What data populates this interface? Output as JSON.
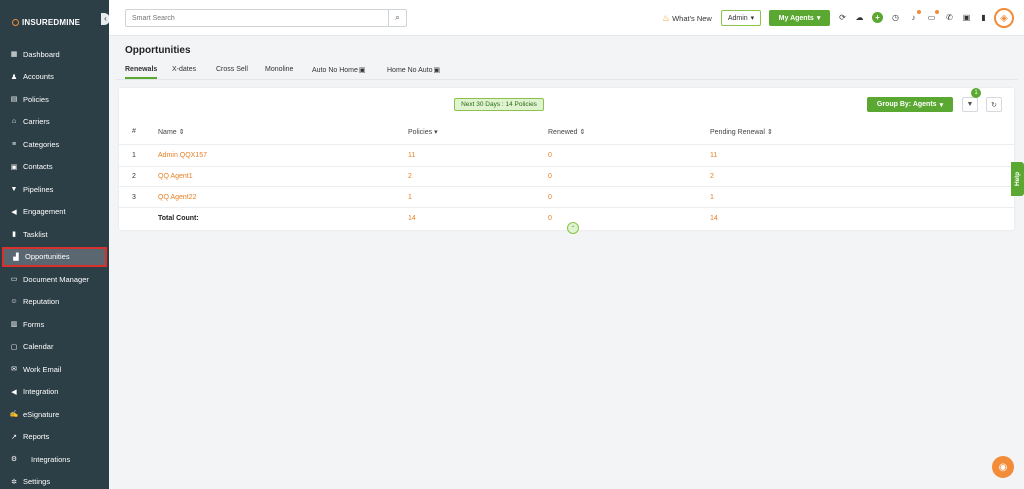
{
  "app": {
    "logo_prefix": "INSURED",
    "logo_suffix": "MINE",
    "collapse_icon": "‹"
  },
  "sidebar": {
    "items": [
      {
        "label": "Dashboard",
        "icon": "dashboard-icon",
        "glyph": "▦"
      },
      {
        "label": "Accounts",
        "icon": "accounts-icon",
        "glyph": "♟"
      },
      {
        "label": "Policies",
        "icon": "policies-icon",
        "glyph": "▤"
      },
      {
        "label": "Carriers",
        "icon": "carriers-icon",
        "glyph": "⌂"
      },
      {
        "label": "Categories",
        "icon": "categories-icon",
        "glyph": "≡"
      },
      {
        "label": "Contacts",
        "icon": "contacts-icon",
        "glyph": "▣"
      },
      {
        "label": "Pipelines",
        "icon": "pipelines-icon",
        "glyph": "▼"
      },
      {
        "label": "Engagement",
        "icon": "engagement-icon",
        "glyph": "◀"
      },
      {
        "label": "Tasklist",
        "icon": "tasklist-icon",
        "glyph": "▮"
      },
      {
        "label": "Opportunities",
        "icon": "opportunities-icon",
        "glyph": "▟",
        "active": true
      },
      {
        "label": "Document Manager",
        "icon": "folder-icon",
        "glyph": "▭"
      },
      {
        "label": "Reputation",
        "icon": "reputation-icon",
        "glyph": "☺"
      },
      {
        "label": "Forms",
        "icon": "forms-icon",
        "glyph": "▥"
      },
      {
        "label": "Calendar",
        "icon": "calendar-icon",
        "glyph": "▢"
      },
      {
        "label": "Work Email",
        "icon": "email-icon",
        "glyph": "✉"
      },
      {
        "label": "Integration",
        "icon": "integration-icon",
        "glyph": "◀"
      },
      {
        "label": "eSignature",
        "icon": "esignature-icon",
        "glyph": "✍"
      },
      {
        "label": "Reports",
        "icon": "reports-icon",
        "glyph": "↗"
      },
      {
        "label": "Integrations",
        "icon": "integrations-icon",
        "glyph": "⚙"
      },
      {
        "label": "Settings",
        "icon": "settings-icon",
        "glyph": "✲"
      }
    ]
  },
  "topbar": {
    "search_placeholder": "Smart Search",
    "search_icon": "⌕",
    "whats_new": "What's New",
    "admin_value": "Admin",
    "my_agents": "My Agents",
    "caret": "▾"
  },
  "page": {
    "title": "Opportunities",
    "tabs": [
      "Renewals",
      "X-dates",
      "Cross Sell",
      "Monoline",
      "Auto No Home",
      "Home No Auto"
    ],
    "tab_chip": "▣"
  },
  "card": {
    "badge": "Next 30 Days : 14 Policies",
    "group_by": "Group By: Agents",
    "filter_count": "1",
    "filter_glyph": "▼",
    "refresh_glyph": "↻",
    "columns": [
      "#",
      "Name ⇕",
      "Policies ▾",
      "Renewed ⇕",
      "Pending Renewal ⇕"
    ],
    "rows": [
      {
        "n": "1",
        "name": "Admin QQX157",
        "policies": "11",
        "renewed": "0",
        "pending": "11"
      },
      {
        "n": "2",
        "name": "QQ Agent1",
        "policies": "2",
        "renewed": "0",
        "pending": "2"
      },
      {
        "n": "3",
        "name": "QQ Agent22",
        "policies": "1",
        "renewed": "0",
        "pending": "1"
      }
    ],
    "total": {
      "label": "Total Count:",
      "policies": "14",
      "renewed": "0",
      "pending": "14"
    },
    "scroll_top_glyph": "⌃"
  },
  "help": {
    "label": "Help"
  },
  "chat_glyph": "◉",
  "colors": {
    "sidebar_bg": "#2c3e46",
    "accent_green": "#5aa832",
    "link_orange": "#e67e22",
    "active_border": "#d9302e"
  }
}
